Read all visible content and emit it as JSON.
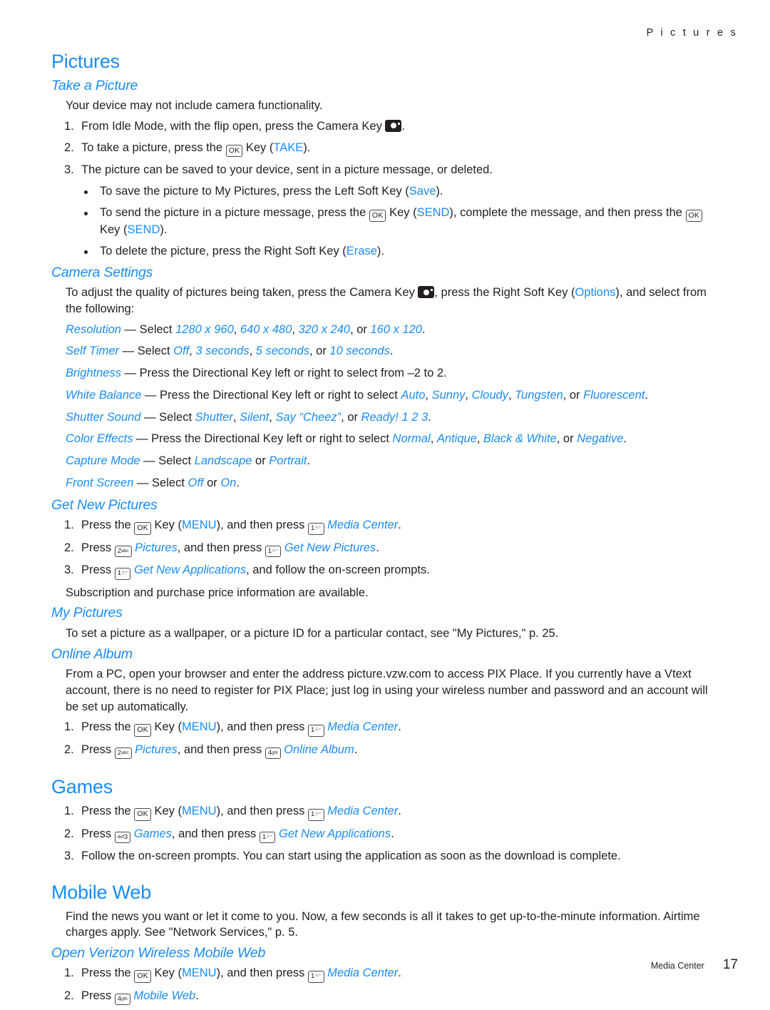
{
  "header": {
    "running_head": "P i c t u r e s"
  },
  "footer": {
    "section": "Media Center",
    "page_number": "17"
  },
  "icons": {
    "camera_key": "camera-key-icon",
    "ok_key": "OK",
    "key1": {
      "num": "1",
      "letters": "☉⁺"
    },
    "key2": {
      "num": "2",
      "letters": "abc"
    },
    "key3": {
      "num": "3",
      "letters": "def"
    },
    "key4": {
      "num": "4",
      "letters": "ghi"
    }
  },
  "colors": {
    "accent": "#1a8cf5",
    "text": "#231f20"
  },
  "pictures": {
    "title": "Pictures",
    "take_a_picture": {
      "title": "Take a Picture",
      "intro": "Your device may not include camera functionality.",
      "step1": {
        "num": "1.",
        "before": "From Idle Mode, with the flip open, press the Camera Key",
        "after": "."
      },
      "step2": {
        "num": "2.",
        "before": "To take a picture, press the",
        "mid": "Key (",
        "action": "TAKE",
        "after": ")."
      },
      "step3": {
        "num": "3.",
        "text": "The picture can be saved to your device, sent in a picture message, or deleted."
      },
      "bullet1": {
        "before": "To save the picture to My Pictures, press the Left Soft Key (",
        "action": "Save",
        "after": ")."
      },
      "bullet2": {
        "before": "To send the picture in a picture message, press the",
        "mid1": "Key (",
        "action1": "SEND",
        "mid2": "), complete the message, and then press the",
        "mid3": "Key (",
        "action2": "SEND",
        "after": ")."
      },
      "bullet3": {
        "before": "To delete the picture, press the Right Soft Key (",
        "action": "Erase",
        "after": ")."
      }
    },
    "camera_settings": {
      "title": "Camera Settings",
      "intro_before": "To adjust the quality of pictures being taken, press the Camera Key",
      "intro_mid": ", press the Right Soft Key (",
      "intro_action": "Options",
      "intro_after": "), and select from the following:",
      "options": [
        {
          "name": "Resolution",
          "dash": "— Select",
          "values": [
            "1280 x 960",
            "640 x 480",
            "320 x 240",
            "160 x 120"
          ],
          "sep": ", ",
          "or": ", or ",
          "end": "."
        },
        {
          "name": "Self Timer",
          "dash": "— Select",
          "values": [
            "Off",
            "3 seconds",
            "5 seconds",
            "10 seconds"
          ],
          "sep": ", ",
          "or": ", or ",
          "end": "."
        },
        {
          "name": "Brightness",
          "dash": "— Press the Directional Key left or right to select from –2 to 2.",
          "values": [],
          "plain": true
        },
        {
          "name": "White Balance",
          "dash": "— Press the Directional Key left or right to select",
          "values": [
            "Auto",
            "Sunny",
            "Cloudy",
            "Tungsten",
            "Fluorescent"
          ],
          "sep": ", ",
          "or": ", or ",
          "end": "."
        },
        {
          "name": "Shutter Sound",
          "dash": "— Select",
          "values": [
            "Shutter",
            "Silent",
            "Say “Cheez”",
            "Ready! 1 2 3"
          ],
          "sep": ", ",
          "or": ", or ",
          "end": "."
        },
        {
          "name": "Color Effects",
          "dash": "— Press the Directional Key left or right to select",
          "values": [
            "Normal",
            "Antique",
            "Black & White",
            "Negative"
          ],
          "sep": ", ",
          "or": ", or ",
          "end": "."
        },
        {
          "name": "Capture Mode",
          "dash": "— Select",
          "values": [
            "Landscape",
            "Portrait"
          ],
          "sep": ", ",
          "or": " or ",
          "end": "."
        },
        {
          "name": "Front Screen",
          "dash": "— Select",
          "values": [
            "Off",
            "On"
          ],
          "sep": ", ",
          "or": " or ",
          "end": "."
        }
      ]
    },
    "get_new_pictures": {
      "title": "Get New Pictures",
      "step1": {
        "num": "1.",
        "a": "Press the",
        "b": "Key (",
        "menu": "MENU",
        "c": "), and then press",
        "target": "Media Center",
        "end": "."
      },
      "step2": {
        "num": "2.",
        "a": "Press",
        "target1": "Pictures",
        "b": ", and then press",
        "target2": "Get New Pictures",
        "end": "."
      },
      "step3": {
        "num": "3.",
        "a": "Press",
        "target": "Get New Applications",
        "b": ", and follow the on-screen prompts."
      },
      "note": "Subscription and purchase price information are available."
    },
    "my_pictures": {
      "title": "My Pictures",
      "text": "To set a picture as a wallpaper, or a picture ID for a particular contact, see \"My Pictures,\" p. 25."
    },
    "online_album": {
      "title": "Online Album",
      "text": "From a PC, open your browser and enter the address picture.vzw.com to access PIX Place. If you currently have a Vtext account, there is no need to register for PIX Place; just log in using your wireless number and password and an account will be set up automatically.",
      "step1": {
        "num": "1.",
        "a": "Press the",
        "b": "Key (",
        "menu": "MENU",
        "c": "), and then press",
        "target": "Media Center",
        "end": "."
      },
      "step2": {
        "num": "2.",
        "a": "Press",
        "target1": "Pictures",
        "b": ", and then press",
        "target2": "Online Album",
        "end": "."
      }
    }
  },
  "games": {
    "title": "Games",
    "step1": {
      "num": "1.",
      "a": "Press the",
      "b": "Key (",
      "menu": "MENU",
      "c": "), and then press",
      "target": "Media Center",
      "end": "."
    },
    "step2": {
      "num": "2.",
      "a": "Press",
      "target1": "Games",
      "b": ", and then press",
      "target2": "Get New Applications",
      "end": "."
    },
    "step3": {
      "num": "3.",
      "text": "Follow the on-screen prompts. You can start using the application as soon as the download is complete."
    }
  },
  "mobile_web": {
    "title": "Mobile Web",
    "intro": "Find the news you want or let it come to you. Now, a few seconds is all it takes to get up-to-the-minute information. Airtime charges apply. See \"Network Services,\" p. 5.",
    "open_section": {
      "title": "Open Verizon Wireless Mobile Web",
      "step1": {
        "num": "1.",
        "a": "Press the",
        "b": "Key (",
        "menu": "MENU",
        "c": "), and then press",
        "target": "Media Center",
        "end": "."
      },
      "step2": {
        "num": "2.",
        "a": "Press",
        "target": "Mobile Web",
        "end": "."
      }
    }
  }
}
